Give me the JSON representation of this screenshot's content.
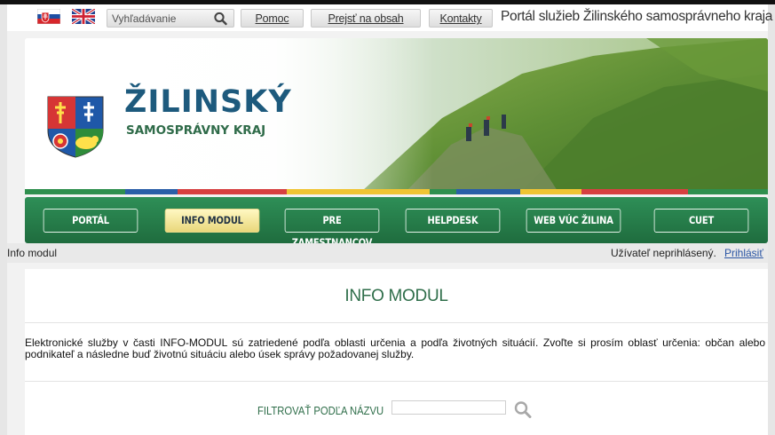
{
  "topbar": {
    "search_placeholder": "Vyhľadávanie",
    "links": {
      "help": "Pomoc",
      "skip": "Prejsť na obsah",
      "contacts": "Kontakty"
    },
    "portal_title": "Portál služieb Žilinského samosprávneho kraja"
  },
  "logo": {
    "line1": "ŽILINSKÝ",
    "line2": "SAMOSPRÁVNY KRAJ"
  },
  "stripe_colors": [
    "#2f8f4e",
    "#2a5fa8",
    "#d64040",
    "#f0c433",
    "#2f8f4e",
    "#2a5fa8",
    "#f0c433",
    "#d64040",
    "#2f8f4e"
  ],
  "nav": [
    {
      "label": "PORTÁL",
      "active": false
    },
    {
      "label": "INFO MODUL",
      "active": true
    },
    {
      "label": "PRE ZAMESTNANCOV",
      "active": false
    },
    {
      "label": "HELPDESK",
      "active": false
    },
    {
      "label": "WEB VÚC ŽILINA",
      "active": false
    },
    {
      "label": "CUET",
      "active": false
    }
  ],
  "breadcrumb": "Info modul",
  "user": {
    "status": "Užívateľ neprihlásený.",
    "login": "Prihlásiť"
  },
  "content": {
    "title": "INFO MODUL",
    "intro": "Elektronické služby v časti INFO-MODUL sú zatriedené podľa oblasti určenia a podľa životných situácií. Zvoľte si prosím oblasť určenia: občan alebo podnikateľ a následne buď životnú situáciu alebo úsek správy požadovanej služby.",
    "filter_label": "FILTROVAŤ PODĽA NÁZVU",
    "filter_value": ""
  },
  "colors": {
    "green": "#2f6e4a",
    "nav_green": "#267a48",
    "active_tab": "#f4e7a0",
    "link_blue": "#2a55a4"
  },
  "icons": [
    "slovak-flag-icon",
    "uk-flag-icon",
    "search-icon",
    "coat-of-arms-icon",
    "filter-search-icon"
  ]
}
